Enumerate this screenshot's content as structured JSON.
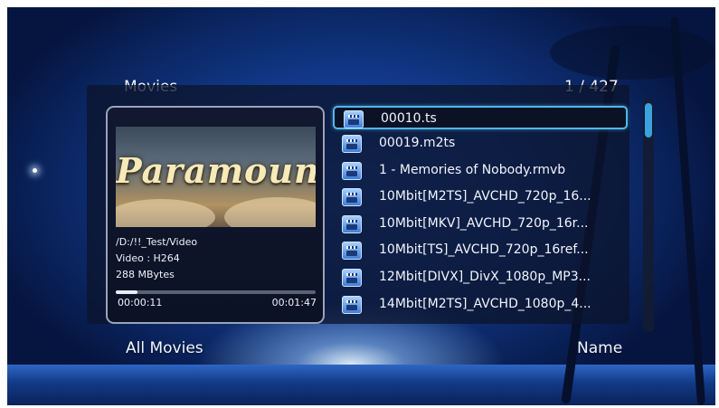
{
  "header": {
    "title": "Movies",
    "counter": "1 / 427"
  },
  "preview": {
    "thumbnail_text": "Paramount",
    "path": "/D:/!!_Test/Video",
    "codec": "Video : H264",
    "size": "288 MBytes",
    "elapsed": "00:00:11",
    "duration": "00:01:47",
    "progress": 0.11
  },
  "files": [
    {
      "name": "00010.ts",
      "icon": "video-file-icon",
      "selected": true
    },
    {
      "name": "00019.m2ts",
      "icon": "video-file-icon",
      "selected": false
    },
    {
      "name": "1 - Memories of Nobody.rmvb",
      "icon": "video-file-icon",
      "selected": false
    },
    {
      "name": "10Mbit[M2TS]_AVCHD_720p_16...",
      "icon": "video-file-icon",
      "selected": false
    },
    {
      "name": "10Mbit[MKV]_AVCHD_720p_16r...",
      "icon": "video-file-icon",
      "selected": false
    },
    {
      "name": "10Mbit[TS]_AVCHD_720p_16ref...",
      "icon": "video-file-icon",
      "selected": false
    },
    {
      "name": "12Mbit[DIVX]_DivX_1080p_MP3...",
      "icon": "video-file-icon",
      "selected": false
    },
    {
      "name": "14Mbit[M2TS]_AVCHD_1080p_4...",
      "icon": "video-file-icon",
      "selected": false
    }
  ],
  "footer": {
    "filter_label": "All Movies",
    "sort_label": "Name"
  },
  "colors": {
    "selection_border": "#52b6ea",
    "scroll_thumb": "#3aa2dd",
    "panel_bg": "rgba(12,20,44,0.76)"
  }
}
